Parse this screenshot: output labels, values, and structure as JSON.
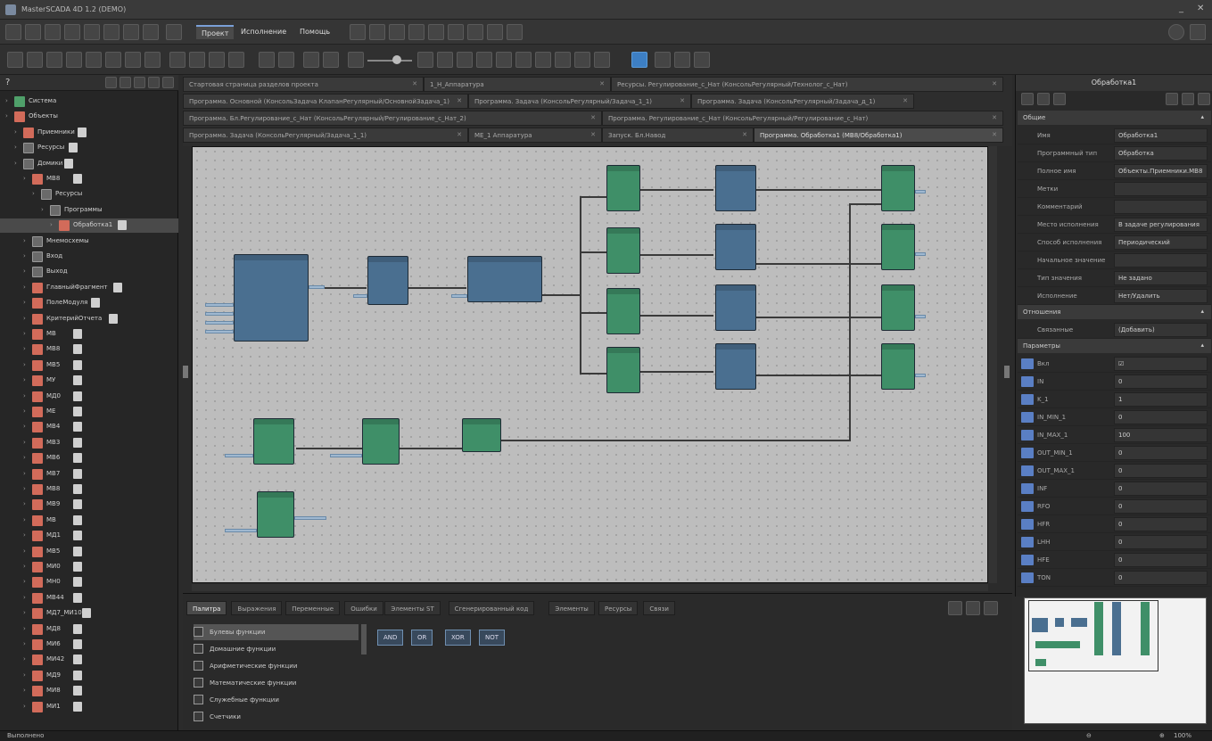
{
  "titlebar": {
    "title": "MasterSCADA 4D 1.2 (DEMO)",
    "min": "_",
    "close": "✕"
  },
  "menubar": {
    "tabs": [
      {
        "label": "Проект"
      },
      {
        "label": "Исполнение"
      },
      {
        "label": "Помощь"
      }
    ],
    "help_icon": "question-icon",
    "settings_icon": "gear-icon"
  },
  "toolbar": {
    "slider_value": "100%"
  },
  "tree": {
    "items": [
      {
        "label": "Система",
        "icon": "green",
        "indent": 0
      },
      {
        "label": "Объекты",
        "icon": "red",
        "indent": 0
      },
      {
        "label": "Приемники",
        "icon": "red",
        "indent": 1
      },
      {
        "label": "Ресурсы",
        "icon": "gray",
        "indent": 1
      },
      {
        "label": "Домики",
        "icon": "gray",
        "indent": 1
      },
      {
        "label": "МВ8",
        "icon": "red",
        "indent": 2
      },
      {
        "label": "Ресурсы",
        "icon": "gray",
        "indent": 3
      },
      {
        "label": "Программы",
        "icon": "gray",
        "indent": 4
      },
      {
        "label": "Обработка1",
        "icon": "red",
        "indent": 5
      },
      {
        "label": "Мнемосхемы",
        "icon": "gray",
        "indent": 2
      },
      {
        "label": "Вход",
        "icon": "gray",
        "indent": 2
      },
      {
        "label": "Выход",
        "icon": "gray",
        "indent": 2
      },
      {
        "label": "ГлавныйФрагмент",
        "icon": "red",
        "indent": 2
      },
      {
        "label": "ПолеМодуля",
        "icon": "red",
        "indent": 2
      },
      {
        "label": "КритерийОтчета",
        "icon": "red",
        "indent": 2
      },
      {
        "label": "МВ",
        "icon": "red",
        "indent": 2
      },
      {
        "label": "МВ8",
        "icon": "red",
        "indent": 2
      },
      {
        "label": "МВ5",
        "icon": "red",
        "indent": 2
      },
      {
        "label": "МУ",
        "icon": "red",
        "indent": 2
      },
      {
        "label": "МД0",
        "icon": "red",
        "indent": 2
      },
      {
        "label": "МЕ",
        "icon": "red",
        "indent": 2
      },
      {
        "label": "МВ4",
        "icon": "red",
        "indent": 2
      },
      {
        "label": "МВ3",
        "icon": "red",
        "indent": 2
      },
      {
        "label": "МВ6",
        "icon": "red",
        "indent": 2
      },
      {
        "label": "МВ7",
        "icon": "red",
        "indent": 2
      },
      {
        "label": "МВ8",
        "icon": "red",
        "indent": 2
      },
      {
        "label": "МВ9",
        "icon": "red",
        "indent": 2
      },
      {
        "label": "МВ",
        "icon": "red",
        "indent": 2
      },
      {
        "label": "МД1",
        "icon": "red",
        "indent": 2
      },
      {
        "label": "МВ5",
        "icon": "red",
        "indent": 2
      },
      {
        "label": "МИ0",
        "icon": "red",
        "indent": 2
      },
      {
        "label": "МН0",
        "icon": "red",
        "indent": 2
      },
      {
        "label": "МВ44",
        "icon": "red",
        "indent": 2
      },
      {
        "label": "МД7_МИ10",
        "icon": "red",
        "indent": 2
      },
      {
        "label": "МД8",
        "icon": "red",
        "indent": 2
      },
      {
        "label": "МИ6",
        "icon": "red",
        "indent": 2
      },
      {
        "label": "МИ42",
        "icon": "red",
        "indent": 2
      },
      {
        "label": "МД9",
        "icon": "red",
        "indent": 2
      },
      {
        "label": "МИ8",
        "icon": "red",
        "indent": 2
      },
      {
        "label": "МИ1",
        "icon": "red",
        "indent": 2
      }
    ]
  },
  "doc_tabs": [
    {
      "label": "Стартовая страница разделов проекта",
      "row": 0
    },
    {
      "label": "1_Н_Аппаратура",
      "row": 0
    },
    {
      "label": "Ресурсы. Регулирование_с_Нат (КонсольРегулярный/Технолог_с_Нат)",
      "row": 0
    },
    {
      "label": "Программа. Основной (КонсольЗадача КлапанРегулярный/ОсновнойЗадача_1)",
      "row": 1
    },
    {
      "label": "Программа. Задача (КонсольРегулярный/Задача_1_1)",
      "row": 1
    },
    {
      "label": "Программа. Задача (КонсольРегулярный/Задача_д_1)",
      "row": 1
    },
    {
      "label": "Программа. Бл.Регулирование_с_Нат (КонсольРегулярный/Регулирование_с_Нат_2)",
      "row": 2
    },
    {
      "label": "Программа. Регулирование_с_Нат (КонсольРегулярный/Регулирование_с_Нат)",
      "row": 2
    },
    {
      "label": "Программа. Задача (КонсольРегулярный/Задача_1_1)",
      "row": 3
    },
    {
      "label": "МЕ_1 Аппаратура",
      "row": 3
    },
    {
      "label": "Запуск. Бл.Навод",
      "row": 3
    },
    {
      "label": "Программа. Обработка1 (МВ8/Обработка1)",
      "row": 3
    }
  ],
  "bottom": {
    "tabs": [
      {
        "label": "Палитра"
      },
      {
        "label": "Выражения"
      },
      {
        "label": "Переменные"
      },
      {
        "label": "Ошибки"
      },
      {
        "label": "Элементы ST"
      },
      {
        "label": "Сгенерированный код"
      },
      {
        "label": "Элементы"
      },
      {
        "label": "Ресурсы"
      },
      {
        "label": "Связи"
      }
    ],
    "library": [
      {
        "label": "Булевы функции"
      },
      {
        "label": "Домашние функции"
      },
      {
        "label": "Арифметические функции"
      },
      {
        "label": "Математические функции"
      },
      {
        "label": "Служебные функции"
      },
      {
        "label": "Счетчики"
      }
    ],
    "func_buttons": [
      {
        "label": "AND"
      },
      {
        "label": "OR"
      },
      {
        "label": "XOR"
      },
      {
        "label": "NOT"
      }
    ]
  },
  "props": {
    "title": "Обработка1",
    "sections": [
      {
        "label": "Общие"
      },
      {
        "label": "Отношения"
      },
      {
        "label": "Параметры"
      }
    ],
    "general": [
      {
        "key": "Имя",
        "value": "Обработка1"
      },
      {
        "key": "Программный тип",
        "value": "Обработка"
      },
      {
        "key": "Полное имя",
        "value": "Объекты.Приемники.МВ8"
      },
      {
        "key": "Метки",
        "value": ""
      },
      {
        "key": "Комментарий",
        "value": ""
      },
      {
        "key": "Место исполнения",
        "value": "В задаче регулирования"
      },
      {
        "key": "Способ исполнения",
        "value": "Периодический"
      },
      {
        "key": "Начальное значение",
        "value": ""
      },
      {
        "key": "Тип значения",
        "value": "Не задано"
      },
      {
        "key": "Исполнение",
        "value": "Нет/Удалить"
      }
    ],
    "relations": [
      {
        "key": "Связанные",
        "value": "(Добавить)"
      }
    ],
    "params": [
      {
        "key": "Вкл",
        "value": "☑",
        "pic": "bool"
      },
      {
        "key": "IN",
        "value": "0",
        "pic": "REAL"
      },
      {
        "key": "K_1",
        "value": "1",
        "pic": "REAL"
      },
      {
        "key": "IN_MIN_1",
        "value": "0",
        "pic": "REAL"
      },
      {
        "key": "IN_MAX_1",
        "value": "100",
        "pic": "REAL"
      },
      {
        "key": "OUT_MIN_1",
        "value": "0",
        "pic": "REAL"
      },
      {
        "key": "OUT_MAX_1",
        "value": "0",
        "pic": "REAL"
      },
      {
        "key": "INF",
        "value": "0",
        "pic": "REAL"
      },
      {
        "key": "RFO",
        "value": "0",
        "pic": "REAL"
      },
      {
        "key": "HFR",
        "value": "0",
        "pic": "REAL"
      },
      {
        "key": "LHH",
        "value": "0",
        "pic": "REAL"
      },
      {
        "key": "HFE",
        "value": "0",
        "pic": "REAL"
      },
      {
        "key": "TON",
        "value": "0",
        "pic": "REAL"
      }
    ]
  },
  "status": {
    "left": "Выполнено",
    "zoom": "100%"
  }
}
